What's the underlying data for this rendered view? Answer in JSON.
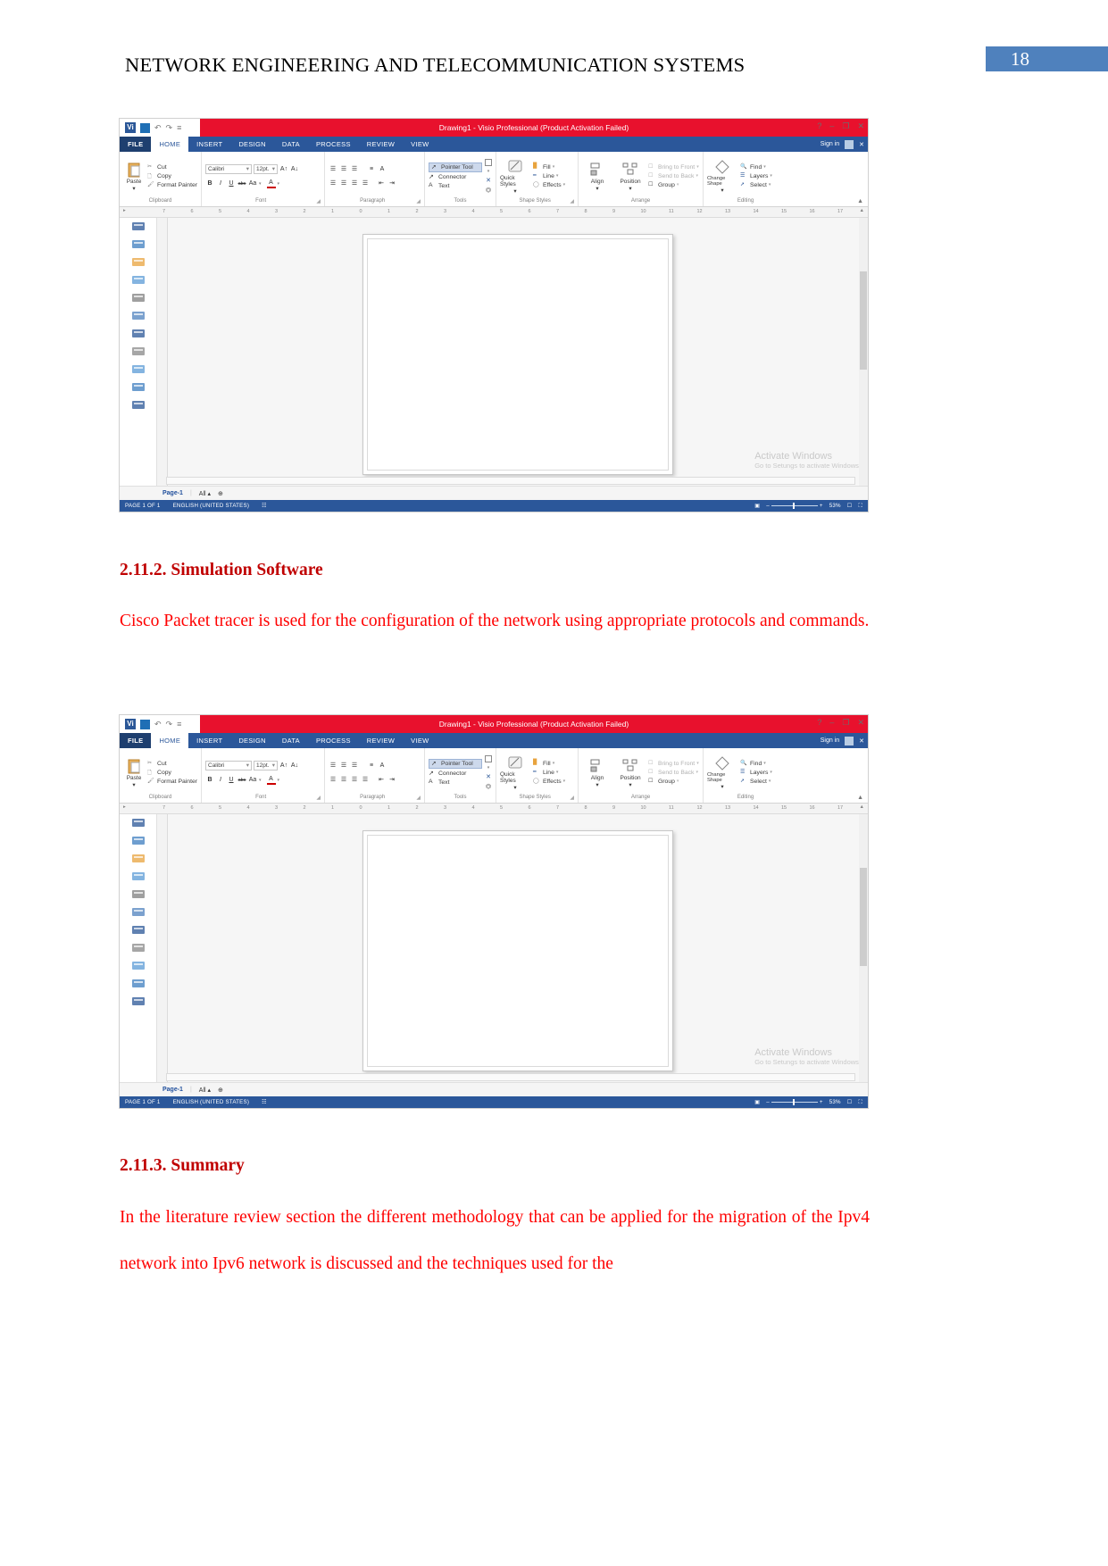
{
  "document": {
    "header_title": "NETWORK ENGINEERING AND TELECOMMUNICATION SYSTEMS",
    "page_number": "18"
  },
  "sections": [
    {
      "heading": "2.11.2. Simulation Software",
      "paragraph": "Cisco Packet tracer is used for the configuration of the network using appropriate protocols and commands."
    },
    {
      "heading": "2.11.3. Summary",
      "paragraph": "In the literature review section the different methodology that can be applied for the migration of the Ipv4 network into Ipv6 network is discussed and the techniques used for the"
    }
  ],
  "visio": {
    "title": "Drawing1 -  Visio Professional (Product Activation Failed)",
    "logo_text": "Vi",
    "quick_access": [
      "save-icon",
      "undo-icon",
      "redo-icon",
      "customize-icon"
    ],
    "window_buttons": [
      "?",
      "–",
      "❐",
      "✕"
    ],
    "sign_in": "Sign in",
    "tabs": [
      {
        "label": "FILE",
        "state": "file"
      },
      {
        "label": "HOME",
        "state": "active"
      },
      {
        "label": "INSERT",
        "state": "normal"
      },
      {
        "label": "DESIGN",
        "state": "normal"
      },
      {
        "label": "DATA",
        "state": "normal"
      },
      {
        "label": "PROCESS",
        "state": "normal"
      },
      {
        "label": "REVIEW",
        "state": "normal"
      },
      {
        "label": "VIEW",
        "state": "normal"
      }
    ],
    "groups": {
      "clipboard": {
        "label": "Clipboard",
        "paste": "Paste",
        "items": [
          "Cut",
          "Copy",
          "Format Painter"
        ]
      },
      "font": {
        "label": "Font",
        "font_name": "Calibri",
        "font_size": "12pt.",
        "grow": "A",
        "shrink": "A",
        "bold": "B",
        "italic": "I",
        "underline": "U",
        "strike": "abc",
        "change_case": "Aa",
        "font_color": "A"
      },
      "paragraph": {
        "label": "Paragraph"
      },
      "tools": {
        "label": "Tools",
        "items": [
          "Pointer Tool",
          "Connector",
          "Text"
        ]
      },
      "shape_styles": {
        "label": "Shape Styles",
        "quick_styles": "Quick Styles",
        "items": [
          "Fill",
          "Line",
          "Effects"
        ]
      },
      "arrange": {
        "label": "Arrange",
        "align": "Align",
        "position": "Position",
        "items": [
          "Bring to Front",
          "Send to Back",
          "Group"
        ]
      },
      "editing": {
        "label": "Editing",
        "change_shape": "Change Shape",
        "items": [
          "Find",
          "Layers",
          "Select"
        ]
      }
    },
    "ruler_h_ticks": [
      "7",
      "6",
      "5",
      "4",
      "3",
      "2",
      "1",
      "0",
      "1",
      "2",
      "3",
      "4",
      "5",
      "6",
      "7",
      "8",
      "9",
      "10",
      "11",
      "12",
      "13",
      "14",
      "15",
      "16",
      "17"
    ],
    "watermark": {
      "line1": "Activate Windows",
      "line2": "Go to Setungs to activate Windows."
    },
    "page_tabs": {
      "page_name": "Page-1",
      "all": "All",
      "add": "⊕"
    },
    "status": {
      "page_of": "PAGE 1 OF 1",
      "language": "ENGLISH (UNITED STATES)",
      "zoom_level": "53%",
      "minus": "–",
      "plus": "+"
    }
  }
}
